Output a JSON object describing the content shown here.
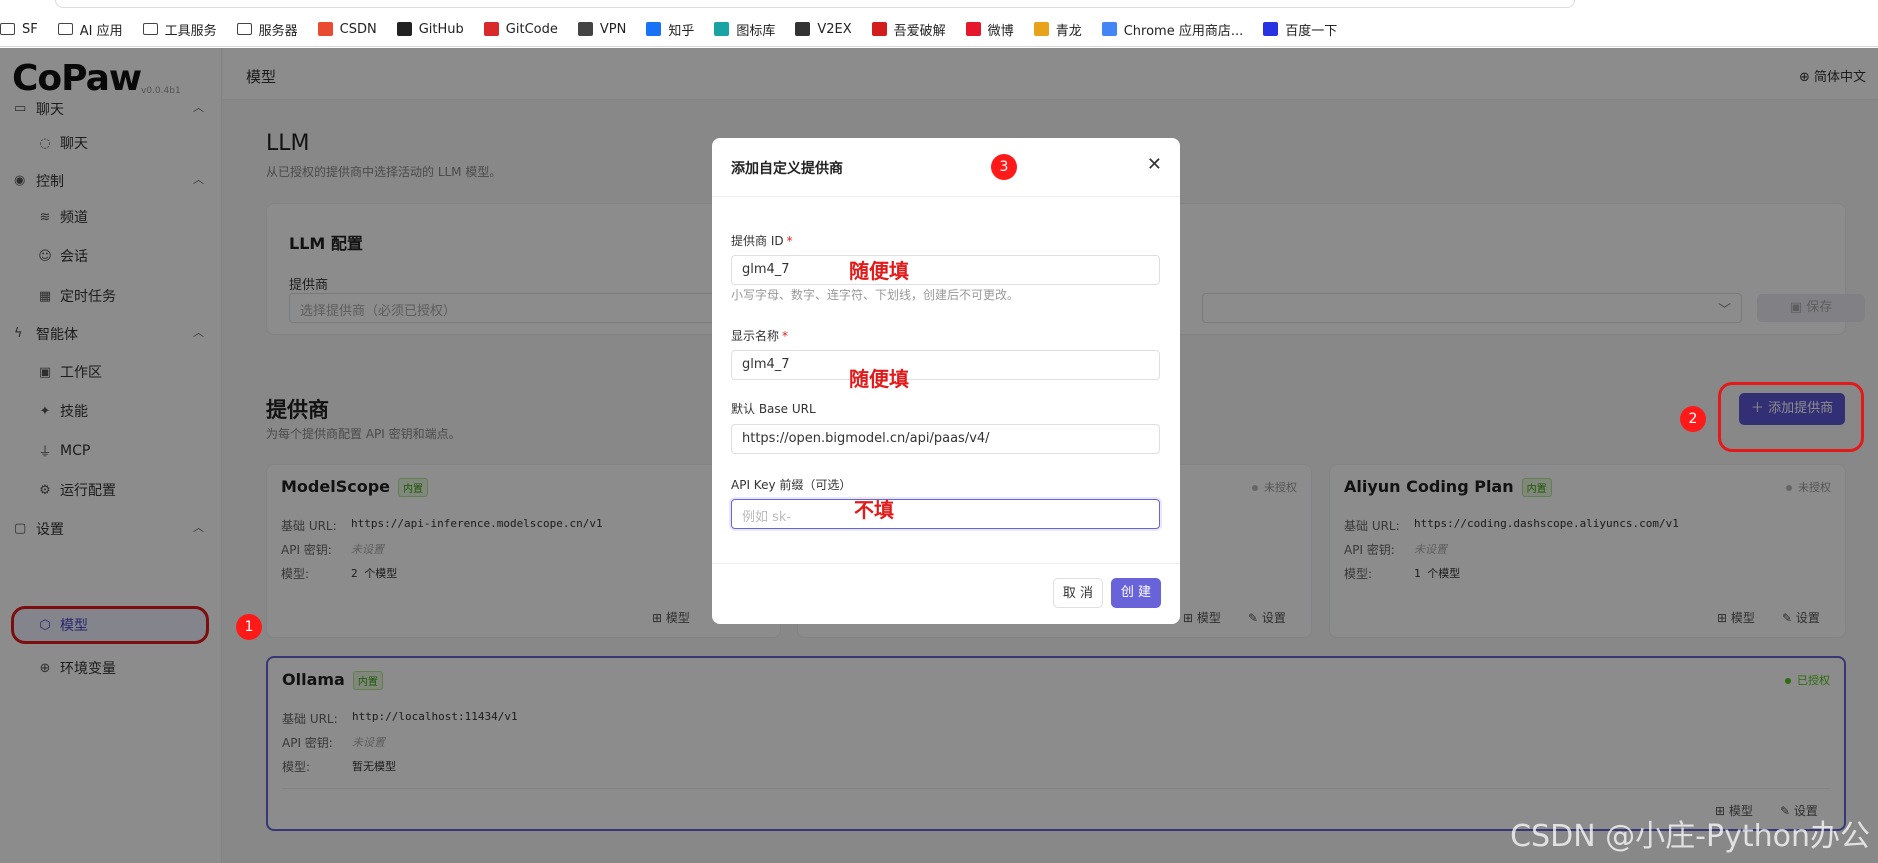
{
  "bookmarks": [
    {
      "label": "SF",
      "icon": "folder-icon"
    },
    {
      "label": "AI 应用",
      "icon": "folder-icon"
    },
    {
      "label": "工具服务",
      "icon": "folder-icon"
    },
    {
      "label": "服务器",
      "icon": "folder-icon"
    },
    {
      "label": "CSDN",
      "icon": "csdn-icon"
    },
    {
      "label": "GitHub",
      "icon": "github-icon"
    },
    {
      "label": "GitCode",
      "icon": "gitcode-icon"
    },
    {
      "label": "VPN",
      "icon": "vpn-icon"
    },
    {
      "label": "知乎",
      "icon": "zhihu-icon"
    },
    {
      "label": "图标库",
      "icon": "iconfont-icon"
    },
    {
      "label": "V2EX",
      "icon": "v2ex-icon"
    },
    {
      "label": "吾爱破解",
      "icon": "52pojie-icon"
    },
    {
      "label": "微博",
      "icon": "weibo-icon"
    },
    {
      "label": "青龙",
      "icon": "qinglong-icon"
    },
    {
      "label": "Chrome 应用商店...",
      "icon": "chrome-store-icon"
    },
    {
      "label": "百度一下",
      "icon": "baidu-icon"
    }
  ],
  "brand": {
    "logo": "CoPaw",
    "version": "v0.0.4b1"
  },
  "sidebar": {
    "group_chat": "聊天",
    "item_chat": "聊天",
    "group_control": "控制",
    "item_channels": "频道",
    "item_sessions": "会话",
    "item_cron": "定时任务",
    "group_agent": "智能体",
    "item_workspace": "工作区",
    "item_skills": "技能",
    "item_mcp": "MCP",
    "item_runconfig": "运行配置",
    "group_settings": "设置",
    "item_models": "模型",
    "item_env": "环境变量"
  },
  "header": {
    "title": "模型",
    "lang": "简体中文"
  },
  "llm": {
    "title": "LLM",
    "subtitle": "从已授权的提供商中选择活动的 LLM 模型。",
    "config_title": "LLM 配置",
    "provider_label": "提供商",
    "provider_placeholder": "选择提供商（必须已授权）",
    "save_label": "保存"
  },
  "providers": {
    "title": "提供商",
    "subtitle": "为每个提供商配置 API 密钥和端点。",
    "add_label": "添加提供商",
    "key_url": "基础 URL:",
    "key_api": "API 密钥:",
    "key_model": "模型:",
    "models_action": "模型",
    "settings_action": "设置",
    "list": [
      {
        "name": "ModelScope",
        "tag": "内置",
        "status": "未授权",
        "url": "https://api-inference.modelscope.cn/v1",
        "api": "未设置",
        "models": "2 个模型"
      },
      {
        "name": "",
        "tag": "",
        "status": "未授权",
        "url": "",
        "api": "",
        "models": ""
      },
      {
        "name": "Aliyun Coding Plan",
        "tag": "内置",
        "status": "未授权",
        "url": "https://coding.dashscope.aliyuncs.com/v1",
        "api": "未设置",
        "models": "1 个模型"
      },
      {
        "name": "Ollama",
        "tag": "内置",
        "status": "已授权",
        "url": "http://localhost:11434/v1",
        "api": "未设置",
        "models": "暂无模型"
      }
    ]
  },
  "modal": {
    "title": "添加自定义提供商",
    "id_label": "提供商 ID",
    "id_value": "glm4_7",
    "id_hint": "小写字母、数字、连字符、下划线，创建后不可更改。",
    "name_label": "显示名称",
    "name_value": "glm4_7",
    "url_label": "默认 Base URL",
    "url_value": "https://open.bigmodel.cn/api/paas/v4/",
    "prefix_label": "API Key 前缀（可选）",
    "prefix_placeholder": "例如 sk-",
    "cancel_label": "取 消",
    "create_label": "创 建"
  },
  "annotations": {
    "step1": "1",
    "step2": "2",
    "step3": "3",
    "note_id": "随便填",
    "note_name": "随便填",
    "note_prefix": "不填"
  },
  "watermark": "CSDN @小庄-Python办公",
  "colors": {
    "accent": "#5b56d6",
    "annotation": "#e31a1a",
    "authorized": "#52c41a"
  }
}
